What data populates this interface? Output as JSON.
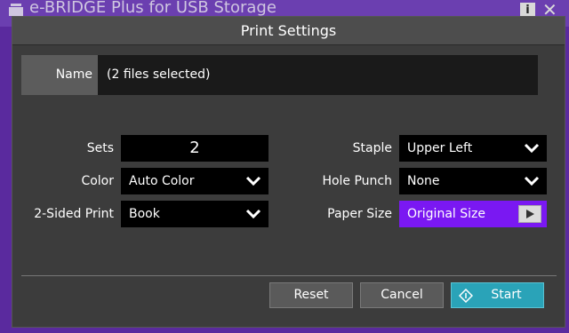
{
  "app": {
    "title": "e-BRIDGE Plus for USB Storage",
    "info_label": "i",
    "close_label": "✕"
  },
  "dialog": {
    "title": "Print Settings",
    "name_label": "Name",
    "name_value": "(2 files selected)",
    "left_fields": [
      {
        "label": "Sets",
        "value": "2"
      },
      {
        "label": "Color",
        "value": "Auto Color"
      },
      {
        "label": "2-Sided Print",
        "value": "Book"
      }
    ],
    "right_fields": [
      {
        "label": "Staple",
        "value": "Upper Left"
      },
      {
        "label": "Hole Punch",
        "value": "None"
      },
      {
        "label": "Paper Size",
        "value": "Original Size"
      }
    ],
    "buttons": {
      "reset": "Reset",
      "cancel": "Cancel",
      "start": "Start"
    }
  },
  "colors": {
    "accent_purple": "#7a18f2",
    "start_teal": "#2aa3b8",
    "background": "#5a2a9e"
  }
}
